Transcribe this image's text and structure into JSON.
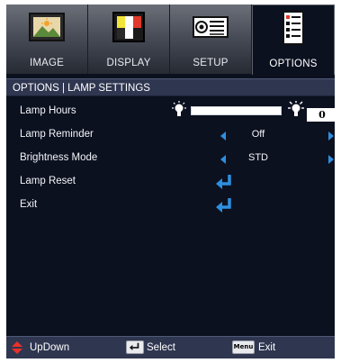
{
  "tabs": [
    {
      "label": "IMAGE",
      "icon": "image-icon",
      "active": false
    },
    {
      "label": "DISPLAY",
      "icon": "display-icon",
      "active": false
    },
    {
      "label": "SETUP",
      "icon": "setup-icon",
      "active": false
    },
    {
      "label": "OPTIONS",
      "icon": "options-icon",
      "active": true
    }
  ],
  "header": {
    "title": "OPTIONS | LAMP SETTINGS"
  },
  "menu": {
    "lamp_hours": {
      "label": "Lamp Hours",
      "value": "0",
      "bar_fraction": 0.0
    },
    "lamp_reminder": {
      "label": "Lamp Reminder",
      "value": "Off"
    },
    "brightness_mode": {
      "label": "Brightness Mode",
      "value": "STD"
    },
    "lamp_reset": {
      "label": "Lamp Reset"
    },
    "exit": {
      "label": "Exit"
    }
  },
  "footer": {
    "updown_label": "UpDown",
    "select_label": "Select",
    "menu_key": "Menu",
    "exit_label": "Exit"
  },
  "colors": {
    "accent": "#2e8fe0",
    "background": "#0c1120",
    "bar": "#2f3650",
    "updown_arrow": "#e8312a"
  }
}
